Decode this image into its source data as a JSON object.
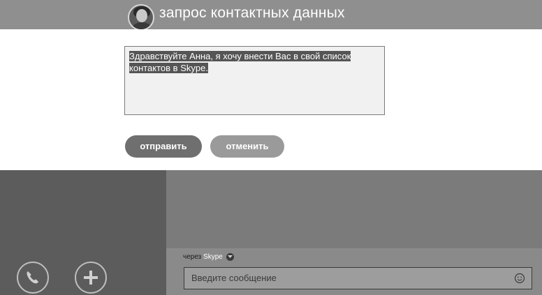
{
  "header": {
    "title": "запрос контактных данных"
  },
  "dialog": {
    "message_line1": "Здравствуйте Анна, я хочу внести Вас в свой список",
    "message_line2": "контактов в Skype.",
    "send_label": "отправить",
    "cancel_label": "отменить"
  },
  "compose": {
    "via_prefix": "через",
    "via_service": "Skype",
    "input_placeholder": "Введите сообщение"
  },
  "icons": {
    "avatar": "contact-avatar",
    "call": "phone-icon",
    "add": "plus-icon",
    "emoji": "smiley-icon",
    "via_dropdown": "chevron-down-icon"
  },
  "colors": {
    "header_bg": "#8f8f8f",
    "send_button": "#6f6f6f",
    "cancel_button": "#9a9a9a",
    "selection": "#555555"
  }
}
